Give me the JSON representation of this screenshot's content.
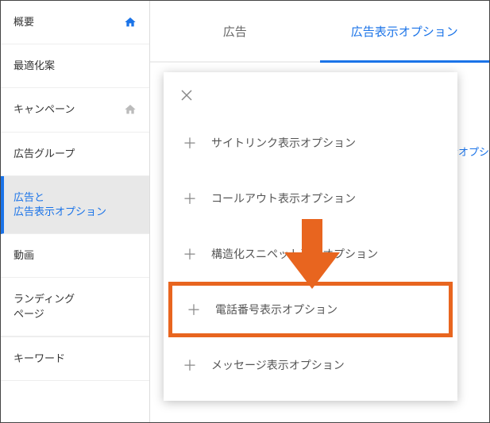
{
  "sidebar": {
    "items": [
      {
        "label": "概要",
        "icon": "home"
      },
      {
        "label": "最適化案"
      },
      {
        "label": "キャンペーン",
        "icon": "home-gray"
      },
      {
        "label": "広告グループ"
      },
      {
        "label": "広告と\n広告表示オプション",
        "active": true
      },
      {
        "label": "動画"
      },
      {
        "label": "ランディング\nページ"
      },
      {
        "label": "キーワード"
      }
    ]
  },
  "tabs": [
    {
      "label": "広告"
    },
    {
      "label": "広告表示オプション",
      "active": true
    }
  ],
  "bg_text": "示オプシ",
  "menu": {
    "items": [
      {
        "label": "サイトリンク表示オプション"
      },
      {
        "label": "コールアウト表示オプション"
      },
      {
        "label": "構造化スニペット表示オプション"
      },
      {
        "label": "電話番号表示オプション",
        "highlighted": true
      },
      {
        "label": "メッセージ表示オプション"
      }
    ]
  },
  "colors": {
    "accent": "#1a73e8",
    "highlight": "#e8651f"
  }
}
